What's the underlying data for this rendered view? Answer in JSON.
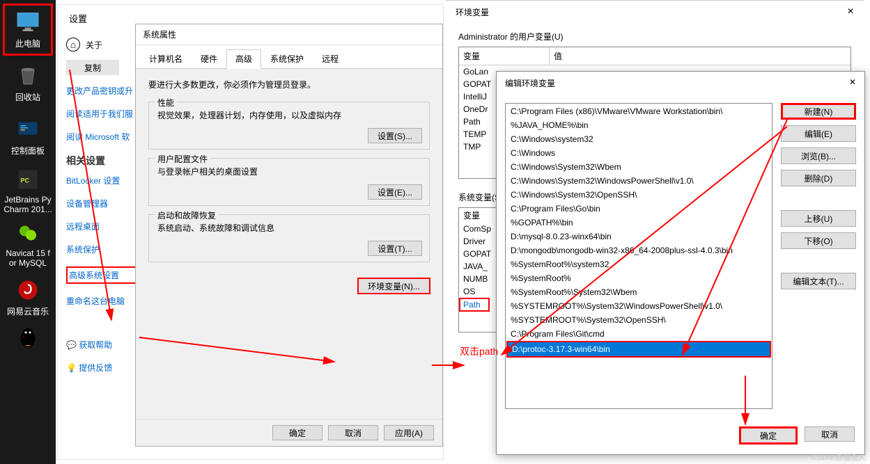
{
  "desktop": {
    "icons": [
      {
        "name": "this-pc",
        "label": "此电脑"
      },
      {
        "name": "recycle-bin",
        "label": "回收站"
      },
      {
        "name": "control-panel",
        "label": "控制面板"
      },
      {
        "name": "pycharm",
        "label": "JetBrains Py\nCharm 201..."
      },
      {
        "name": "navicat",
        "label": "Navicat 15 f\nor MySQL"
      },
      {
        "name": "netease-music",
        "label": "网易云音乐"
      },
      {
        "name": "qq",
        "label": ""
      }
    ]
  },
  "settings": {
    "title": "设置",
    "about": "关于",
    "copy": "复制",
    "links": [
      "更改产品密钥或升",
      "阅读适用于我们服",
      "阅读 Microsoft 软"
    ],
    "related_heading": "相关设置",
    "related": [
      "BitLocker 设置",
      "设备管理器",
      "远程桌面",
      "系统保护",
      "高级系统设置",
      "重命名这台电脑"
    ],
    "help_link": "获取帮助",
    "feedback_link": "提供反馈"
  },
  "sysprop": {
    "title": "系统属性",
    "tabs": [
      "计算机名",
      "硬件",
      "高级",
      "系统保护",
      "远程"
    ],
    "active_tab": 2,
    "warning": "要进行大多数更改，你必须作为管理员登录。",
    "perf": {
      "label": "性能",
      "desc": "视觉效果，处理器计划，内存使用，以及虚拟内存",
      "btn": "设置(S)..."
    },
    "profile": {
      "label": "用户配置文件",
      "desc": "与登录帐户相关的桌面设置",
      "btn": "设置(E)..."
    },
    "startup": {
      "label": "启动和故障恢复",
      "desc": "系统启动、系统故障和调试信息",
      "btn": "设置(T)..."
    },
    "envvar_btn": "环境变量(N)...",
    "ok": "确定",
    "cancel": "取消",
    "apply": "应用(A)"
  },
  "envwin": {
    "title": "环境变量",
    "user_section": "Administrator 的用户变量(U)",
    "col_var": "变量",
    "col_val": "值",
    "user_vars": [
      "GoLan",
      "GOPAT",
      "IntelliJ",
      "OneDr",
      "Path",
      "TEMP",
      "TMP"
    ],
    "sys_section": "系统变量(S)",
    "sys_vars": [
      "变量",
      "ComSp",
      "Driver",
      "GOPAT",
      "JAVA_",
      "NUMB",
      "OS",
      "Path"
    ],
    "annotation": "双击path"
  },
  "editenv": {
    "title": "编辑环境变量",
    "paths": [
      "C:\\Program Files (x86)\\VMware\\VMware Workstation\\bin\\",
      "%JAVA_HOME%\\bin",
      "C:\\Windows\\system32",
      "C:\\Windows",
      "C:\\Windows\\System32\\Wbem",
      "C:\\Windows\\System32\\WindowsPowerShell\\v1.0\\",
      "C:\\Windows\\System32\\OpenSSH\\",
      "C:\\Program Files\\Go\\bin",
      "%GOPATH%\\bin",
      "D:\\mysql-8.0.23-winx64\\bin",
      "D:\\mongodb\\mongodb-win32-x86_64-2008plus-ssl-4.0.3\\bin",
      "%SystemRoot%\\system32",
      "%SystemRoot%",
      "%SystemRoot%\\System32\\Wbem",
      "%SYSTEMROOT%\\System32\\WindowsPowerShell\\v1.0\\",
      "%SYSTEMROOT%\\System32\\OpenSSH\\",
      "C:\\Program Files\\Git\\cmd",
      "D:\\protoc-3.17.3-win64\\bin"
    ],
    "selected_index": 17,
    "buttons": {
      "new": "新建(N)",
      "edit": "编辑(E)",
      "browse": "浏览(B)...",
      "delete": "删除(D)",
      "up": "上移(U)",
      "down": "下移(O)",
      "edit_text": "编辑文本(T)..."
    },
    "ok": "确定",
    "cancel": "取消"
  },
  "watermark": "CSDN @慢泛人"
}
